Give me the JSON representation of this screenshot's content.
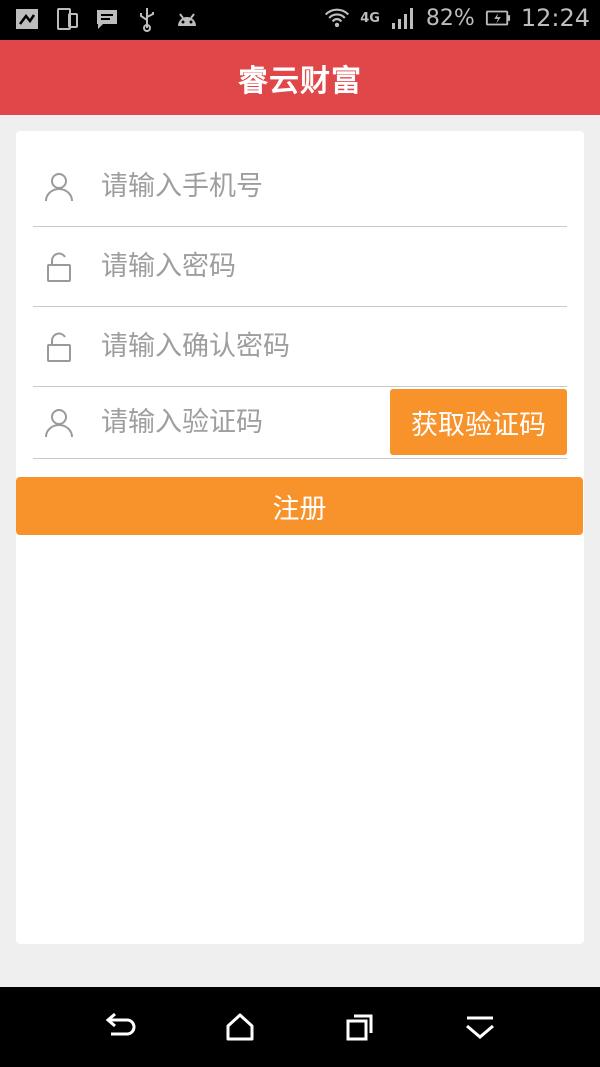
{
  "status_bar": {
    "battery_percent": "82%",
    "time": "12:24",
    "network_type": "4G",
    "icons": [
      "screenshot-icon",
      "device-icon",
      "message-icon",
      "usb-icon",
      "android-icon",
      "wifi-icon",
      "signal-icon",
      "battery-icon"
    ]
  },
  "app_bar": {
    "title": "睿云财富"
  },
  "form": {
    "phone": {
      "placeholder": "请输入手机号",
      "icon": "user-icon"
    },
    "password": {
      "placeholder": "请输入密码",
      "icon": "lock-icon"
    },
    "confirm_password": {
      "placeholder": "请输入确认密码",
      "icon": "lock-icon"
    },
    "verify_code": {
      "placeholder": "请输入验证码",
      "icon": "user-icon",
      "button_label": "获取验证码"
    },
    "register_label": "注册"
  },
  "nav_bar": {
    "icons": [
      "back-icon",
      "home-icon",
      "recents-icon",
      "menu-down-icon"
    ]
  },
  "colors": {
    "app_bar": "#e04748",
    "accent": "#f8922a",
    "background": "#efefef"
  }
}
